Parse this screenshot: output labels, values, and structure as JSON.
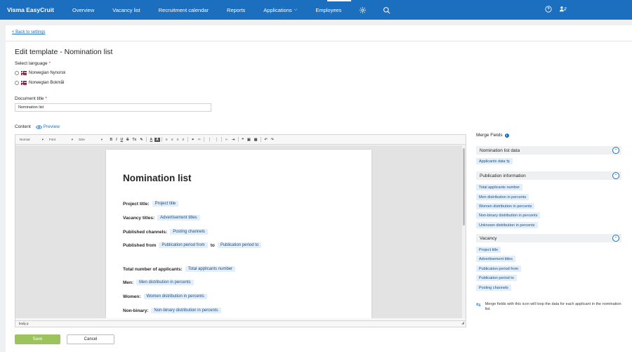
{
  "nav": {
    "brand": "Visma EasyCruit",
    "items": [
      "Overview",
      "Vacancy list",
      "Recruitment calendar",
      "Reports",
      "Applications",
      "Employees"
    ],
    "applications_caret": "⌵",
    "icons": [
      "gear-icon",
      "search-icon",
      "help-icon",
      "user-switch-icon"
    ]
  },
  "back_link": "< Back to settings",
  "page_title": "Edit template - Nomination list",
  "language": {
    "label": "Select language",
    "required": "*",
    "options": [
      "Norwegian Nynorsk",
      "Norwegian Bokmål"
    ]
  },
  "document_title": {
    "label": "Document title",
    "required": "*",
    "value": "Nomination list"
  },
  "content": {
    "label": "Content",
    "preview": "Preview"
  },
  "toolbar": {
    "format": "Normal",
    "font": "Font",
    "size": "Size",
    "caret": "▾",
    "buttons": [
      "B",
      "I",
      "U",
      "S",
      "Tx",
      "✎",
      "A",
      "A",
      "≡",
      "≡",
      "≡",
      "≡",
      "⚭",
      "⚮",
      "⋮",
      "⋮",
      "⇤",
      "⇥",
      "❝",
      "▣",
      "▦",
      "↶",
      "↷"
    ]
  },
  "editor": {
    "heading": "Nomination list",
    "rows": [
      {
        "label": "Project title:",
        "tag": "Project title"
      },
      {
        "label": "Vacancy titles:",
        "tag": "Advertisement titles"
      },
      {
        "label": "Published channels:",
        "tag": "Posting channels"
      },
      {
        "label": "Published from",
        "tag": "Publication period from",
        "to": "to",
        "tag2": "Publication period to"
      },
      {
        "label": "Total number of applicants:",
        "tag": "Total applicants number"
      },
      {
        "label": "Men:",
        "tag": "Men distribution in percents"
      },
      {
        "label": "Women:",
        "tag": "Women distribution in percents"
      },
      {
        "label": "Non-binary:",
        "tag": "Non-binary distribution in percents"
      }
    ],
    "status_path": "body  p"
  },
  "merge_fields": {
    "title": "Merge Fields",
    "info": "i",
    "toggle": "⌃",
    "groups": [
      {
        "name": "Nomination list data",
        "items": [
          "Applicants data ⇆"
        ]
      },
      {
        "name": "Publication information",
        "items": [
          "Total applicants number",
          "Men distribution in percents",
          "Women distribution in percents",
          "Non-binary distribution in percents",
          "Unknown distribution in percents"
        ]
      },
      {
        "name": "Vacancy",
        "items": [
          "Project title",
          "Advertisement titles",
          "Publication period from",
          "Publication period to",
          "Posting channels"
        ]
      }
    ],
    "note": "Merge fields with this icon will loop the data for each applicant in the nomination list."
  },
  "buttons": {
    "save": "Save",
    "cancel": "Cancel"
  },
  "colors": {
    "nav_bg": "#1b6fbe",
    "save_bg": "#9dc35f",
    "tag_bg": "#e2eef9"
  }
}
